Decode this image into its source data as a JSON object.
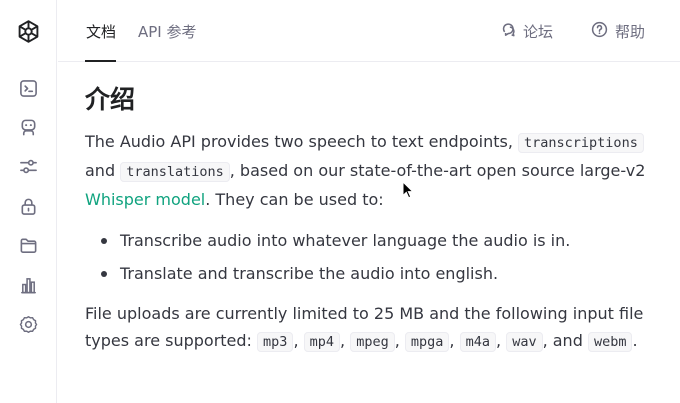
{
  "nav": {
    "tabs": [
      {
        "label": "文档",
        "active": true
      },
      {
        "label": "API 参考",
        "active": false
      }
    ],
    "links": [
      {
        "label": "论坛",
        "icon": "forum-icon"
      },
      {
        "label": "帮助",
        "icon": "help-icon"
      }
    ]
  },
  "sidebar": {
    "logo": "openai-logo",
    "icons": [
      "terminal-icon",
      "robot-icon",
      "sliders-icon",
      "lock-icon",
      "folder-icon",
      "bar-chart-icon",
      "settings-icon"
    ]
  },
  "main": {
    "title": "介绍",
    "intro": {
      "t1": "The Audio API provides two speech to text endpoints,",
      "code1": "transcriptions",
      "t2": "and",
      "code2": "translations",
      "t3": ", based on our state-of-the-art open source large-v2",
      "link": "Whisper model",
      "t4": ". They can be used to:"
    },
    "bullets": [
      "Transcribe audio into whatever language the audio is in.",
      "Translate and transcribe the audio into english."
    ],
    "uploads": {
      "text": "File uploads are currently limited to 25 MB and the following input file types are supported:",
      "types": [
        "mp3",
        "mp4",
        "mpeg",
        "mpga",
        "m4a",
        "wav",
        "webm"
      ],
      "sep": ",",
      "and": ", and",
      "end": "."
    }
  },
  "colors": {
    "accent": "#10a37f",
    "text": "#353740",
    "muted": "#6e6e80",
    "border": "#ececf1",
    "code_bg": "#f7f7f8"
  }
}
